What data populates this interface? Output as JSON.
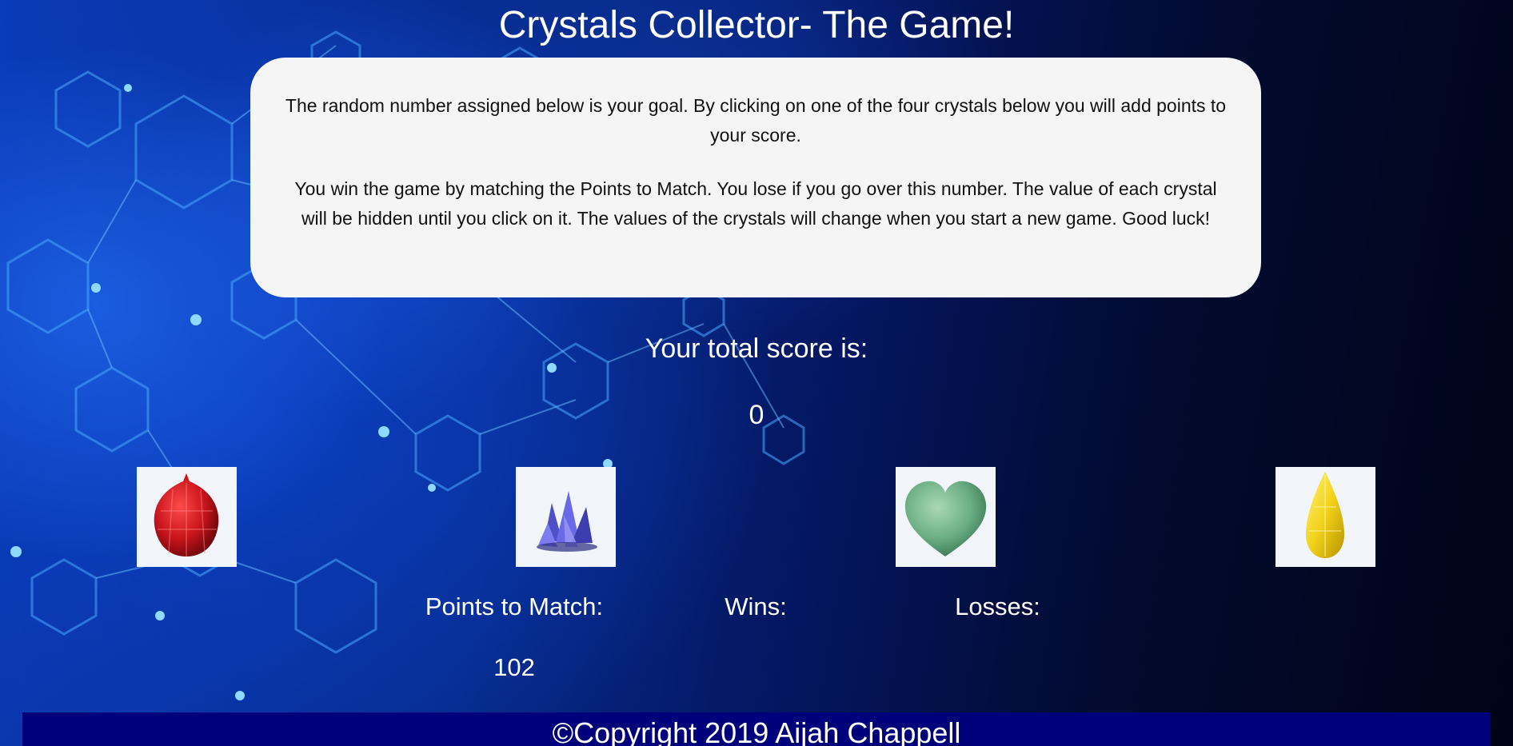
{
  "page": {
    "title": "Crystals Collector- The Game!"
  },
  "instructions": {
    "paragraph1": "The random number assigned below is your goal. By clicking on one of the four crystals below you will add points to your score.",
    "paragraph2": "You win the game by matching the Points to Match. You lose if you go over this number. The value of each crystal will be hidden until you click on it. The values of the crystals will change when you start a new game. Good luck!"
  },
  "score": {
    "label": "Your total score is:",
    "value": "0"
  },
  "crystals": [
    {
      "name": "red-crystal",
      "color": "#c8141b"
    },
    {
      "name": "purple-crystal",
      "color": "#5a5ad8"
    },
    {
      "name": "green-crystal",
      "color": "#6bae84"
    },
    {
      "name": "yellow-crystal",
      "color": "#f2d21a"
    }
  ],
  "stats": {
    "points_label": "Points to Match:",
    "points_value": "102",
    "wins_label": "Wins:",
    "wins_value": "",
    "losses_label": "Losses:",
    "losses_value": ""
  },
  "footer": {
    "copyright": "©Copyright 2019 Aijah Chappell"
  },
  "colors": {
    "panel_background": "#f5f5f5",
    "footer_background": "#00007a",
    "page_background": "#041660"
  }
}
